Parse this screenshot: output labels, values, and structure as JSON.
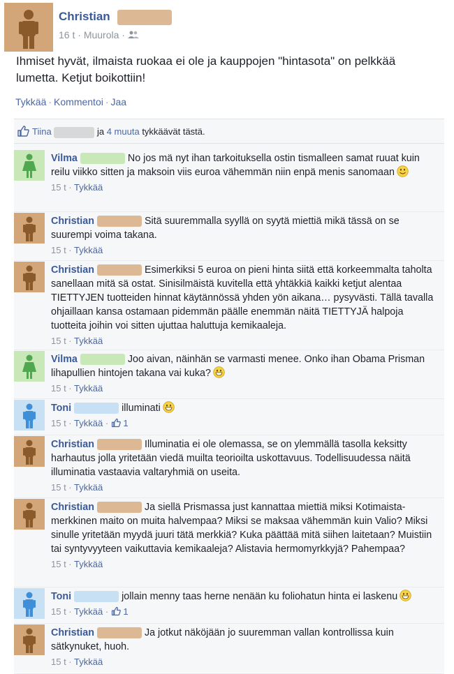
{
  "post": {
    "author": "Christian",
    "time": "16 t",
    "location": "Muurola",
    "text": "Ihmiset hyvät, ilmaista ruokaa ei ole ja kauppojen \"hintasota\" on pelkkää lumetta. Ketjut boikottiin!",
    "actions": {
      "like": "Tykkää",
      "comment": "Kommentoi",
      "share": "Jaa"
    }
  },
  "likes": {
    "first": "Tiina",
    "middle": "ja",
    "others": "4 muuta",
    "suffix": "tykkäävät tästä."
  },
  "colors": {
    "link": "#3b5998",
    "meta": "#8d949e",
    "avatar_male": "#8b5a2b",
    "avatar_female": "#4fa84f",
    "avatar_blue": "#3f8fd8"
  },
  "comments": [
    {
      "author": "Vilma",
      "avatar": "female",
      "text": "No jos mä nyt ihan tarkoituksella ostin tismalleen samat ruuat kuin reilu viikko sitten ja maksoin viis euroa vähemmän niin enpä menis sanomaan",
      "emoji": "smile",
      "time": "15 t",
      "like": "Tykkää",
      "likes": ""
    },
    {
      "author": "Christian",
      "avatar": "male",
      "text": "Sitä suuremmalla syyllä on syytä miettiä mikä tässä on se suurempi voima takana.",
      "emoji": "",
      "time": "15 t",
      "like": "Tykkää",
      "likes": ""
    },
    {
      "author": "Christian",
      "avatar": "male",
      "text": "Esimerkiksi 5 euroa on pieni hinta siitä että korkeemmalta taholta sanellaan mitä sä ostat. Sinisilmäistä kuvitella että yhtäkkiä kaikki ketjut alentaa TIETTYJEN tuotteiden hinnat käytännössä yhden yön aikana… pysyvästi. Tällä tavalla ohjaillaan kansa ostamaan pidemmän päälle enemmän näitä TIETTYJÄ halpoja tuotteita joihin voi sitten ujuttaa haluttuja kemikaaleja.",
      "emoji": "",
      "time": "15 t",
      "like": "Tykkää",
      "likes": ""
    },
    {
      "author": "Vilma",
      "avatar": "female",
      "text": "Joo aivan, näinhän se varmasti menee. Onko ihan Obama Prisman lihapullien hintojen takana vai kuka?",
      "emoji": "grin",
      "time": "15 t",
      "like": "Tykkää",
      "likes": ""
    },
    {
      "author": "Toni",
      "avatar": "blue",
      "text": "illuminati",
      "emoji": "grin",
      "time": "15 t",
      "like": "Tykkää",
      "likes": "1"
    },
    {
      "author": "Christian",
      "avatar": "male",
      "text": "Illuminatia ei ole olemassa, se on ylemmällä tasolla keksitty harhautus jolla yritetään viedä muilta teorioilta uskottavuus. Todellisuudessa näitä illuminatia vastaavia valtaryhmiä on useita.",
      "emoji": "",
      "time": "15 t",
      "like": "Tykkää",
      "likes": ""
    },
    {
      "author": "Christian",
      "avatar": "male",
      "text": "Ja siellä Prismassa just kannattaa miettiä miksi Kotimaista-merkkinen maito on muita halvempaa? Miksi se maksaa vähemmän kuin Valio? Miksi sinulle yritetään myydä juuri tätä merkkiä? Kuka päättää mitä siihen laitetaan? Muistiin tai syntyvyyteen vaikuttavia kemikaaleja? Alistavia hermomyrkkyjä? Pahempaa?",
      "emoji": "",
      "time": "15 t",
      "like": "Tykkää",
      "likes": ""
    },
    {
      "author": "Toni",
      "avatar": "blue",
      "text": "jollain menny taas herne nenään ku foliohatun hinta ei laskenu",
      "emoji": "grin",
      "time": "15 t",
      "like": "Tykkää",
      "likes": "1"
    },
    {
      "author": "Christian",
      "avatar": "male",
      "text": "Ja jotkut näköjään jo suuremman vallan kontrollissa kuin sätkynuket, huoh.",
      "emoji": "",
      "time": "15 t",
      "like": "Tykkää",
      "likes": ""
    }
  ]
}
